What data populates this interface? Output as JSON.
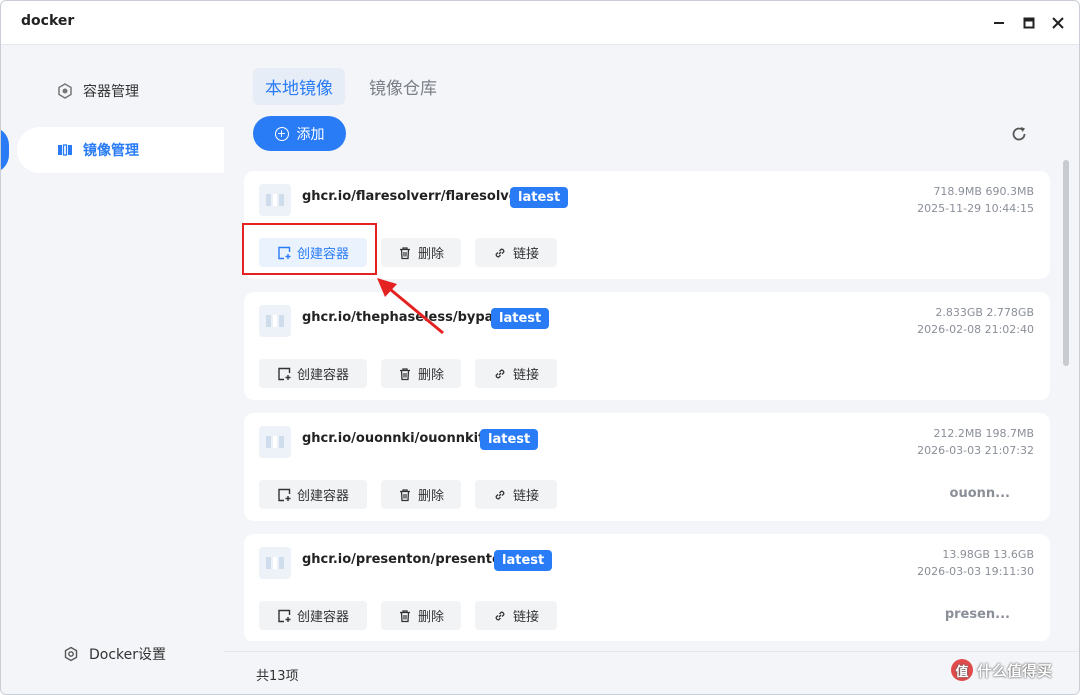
{
  "window": {
    "title": "docker"
  },
  "sidebar": {
    "items": [
      {
        "label": "容器管理",
        "icon": "container-icon",
        "active": false
      },
      {
        "label": "镜像管理",
        "icon": "image-icon",
        "active": true
      }
    ],
    "settings_label": "Docker设置"
  },
  "main": {
    "tabs": [
      {
        "label": "本地镜像",
        "active": true
      },
      {
        "label": "镜像仓库",
        "active": false
      }
    ],
    "add_label": "添加",
    "actions": {
      "create": "创建容器",
      "delete": "删除",
      "link": "链接"
    },
    "images": [
      {
        "name": "ghcr.io/flaresolverr/flaresolverr",
        "tag": "latest",
        "sizes": "718.9MB 690.3MB",
        "date": "2025-11-29 10:44:15",
        "short": ""
      },
      {
        "name": "ghcr.io/thephaseless/byparr",
        "tag": "latest",
        "sizes": "2.833GB 2.778GB",
        "date": "2026-02-08 21:02:40",
        "short": ""
      },
      {
        "name": "ghcr.io/ouonnki/ouonnkitv",
        "tag": "latest",
        "sizes": "212.2MB 198.7MB",
        "date": "2026-03-03 21:07:32",
        "short": "ouonn..."
      },
      {
        "name": "ghcr.io/presenton/presenton",
        "tag": "latest",
        "sizes": "13.98GB 13.6GB",
        "date": "2026-03-03 19:11:30",
        "short": "presen..."
      }
    ],
    "total_label": "共13项"
  },
  "watermark": {
    "text": "什么值得买",
    "logo": "值"
  },
  "colors": {
    "accent": "#2a7cf6",
    "highlight_box": "#e52222"
  }
}
